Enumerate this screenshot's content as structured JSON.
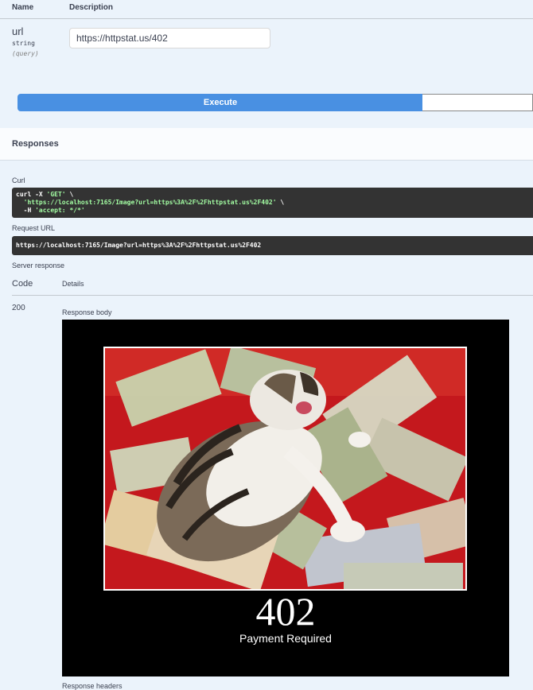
{
  "params": {
    "header_name": "Name",
    "header_description": "Description",
    "param": {
      "name": "url",
      "type": "string",
      "in": "(query)",
      "value": "https://httpstat.us/402"
    }
  },
  "execute": {
    "label": "Execute"
  },
  "responses": {
    "title": "Responses",
    "curl_label": "Curl",
    "curl": {
      "line1_cmd": "curl -X ",
      "line1_method": "'GET'",
      "line1_end": " \\",
      "line2_url": "'https://localhost:7165/Image?url=https%3A%2F%2Fhttpstat.us%2F402'",
      "line2_end": " \\",
      "line3_flag": "  -H ",
      "line3_header": "'accept: */*'"
    },
    "request_url_label": "Request URL",
    "request_url": "https://localhost:7165/Image?url=https%3A%2F%2Fhttpstat.us%2F402",
    "server_response_label": "Server response",
    "col_code": "Code",
    "col_details": "Details",
    "code": "200",
    "body_label": "Response body",
    "image": {
      "big": "402",
      "caption": "Payment Required"
    },
    "headers_label": "Response headers"
  }
}
